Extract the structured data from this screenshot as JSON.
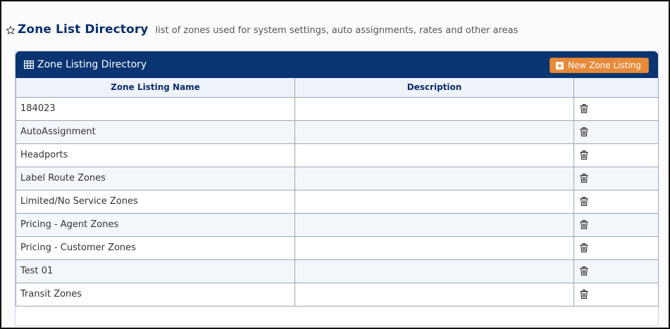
{
  "page": {
    "title": "Zone List Directory",
    "subtitle": "list of zones used for system settings, auto assignments, rates and other areas",
    "title_icon": "star-icon"
  },
  "panel": {
    "title": "Zone Listing Directory",
    "title_icon": "grid-icon",
    "new_button_label": "New Zone Listing",
    "new_button_icon": "plus-square-icon",
    "header_color": "#0b3472",
    "button_color": "#e78a3a"
  },
  "table": {
    "columns": [
      "Zone Listing Name",
      "Description",
      ""
    ],
    "rows": [
      {
        "name": "184023",
        "description": ""
      },
      {
        "name": "AutoAssignment",
        "description": ""
      },
      {
        "name": "Headports",
        "description": ""
      },
      {
        "name": "Label Route Zones",
        "description": ""
      },
      {
        "name": "Limited/No Service Zones",
        "description": ""
      },
      {
        "name": "Pricing - Agent Zones",
        "description": ""
      },
      {
        "name": "Pricing - Customer Zones",
        "description": ""
      },
      {
        "name": "Test 01",
        "description": ""
      },
      {
        "name": "Transit Zones",
        "description": ""
      }
    ],
    "row_action_icon": "trash-icon"
  }
}
